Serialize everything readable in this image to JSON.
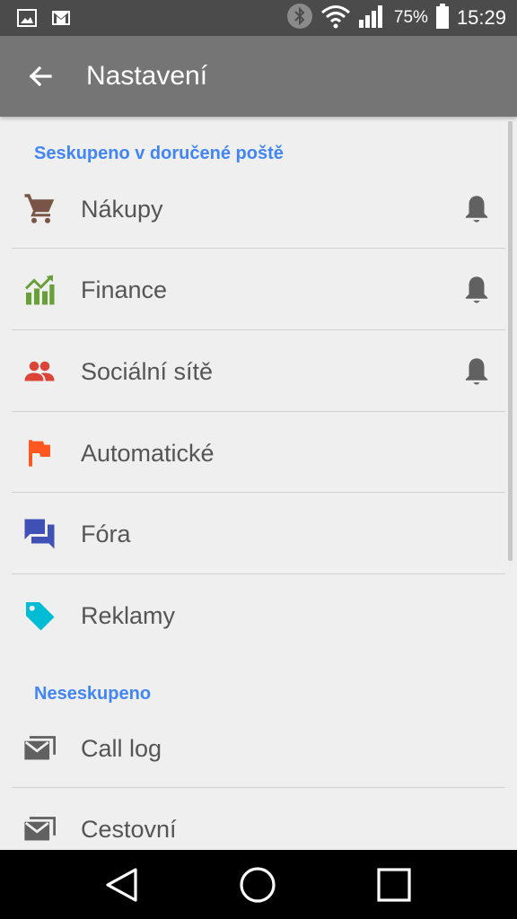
{
  "status_bar": {
    "battery_percent": "75%",
    "time": "15:29",
    "icons": [
      "image-icon",
      "gmail-icon",
      "bluetooth-icon",
      "wifi-icon",
      "signal-icon",
      "battery-icon"
    ]
  },
  "app_bar": {
    "title": "Nastavení",
    "back_icon": "arrow-back-icon"
  },
  "sections": {
    "grouped": {
      "header": "Seskupeno v doručené poště",
      "items": [
        {
          "label": "Nákupy",
          "icon": "cart-icon",
          "color": "#795548",
          "bell": true
        },
        {
          "label": "Finance",
          "icon": "chart-icon",
          "color": "#689f38",
          "bell": true
        },
        {
          "label": "Sociální sítě",
          "icon": "people-icon",
          "color": "#db4437",
          "bell": true
        },
        {
          "label": "Automatické",
          "icon": "flag-icon",
          "color": "#ff5722",
          "bell": false
        },
        {
          "label": "Fóra",
          "icon": "forum-icon",
          "color": "#3f51b5",
          "bell": false
        },
        {
          "label": "Reklamy",
          "icon": "tag-icon",
          "color": "#00bcd4",
          "bell": false
        }
      ]
    },
    "ungrouped": {
      "header": "Neseskupeno",
      "items": [
        {
          "label": "Call log",
          "icon": "mail-icon",
          "color": "#616161"
        },
        {
          "label": "Cestovní",
          "icon": "mail-icon",
          "color": "#616161"
        }
      ]
    }
  },
  "colors": {
    "status_bar": "#4b4b4b",
    "app_bar": "#757575",
    "background": "#efefef",
    "section_header": "#4285f4",
    "bell": "#616161"
  },
  "nav_bar": {
    "buttons": [
      "back-triangle-icon",
      "home-circle-icon",
      "recents-square-icon"
    ]
  }
}
